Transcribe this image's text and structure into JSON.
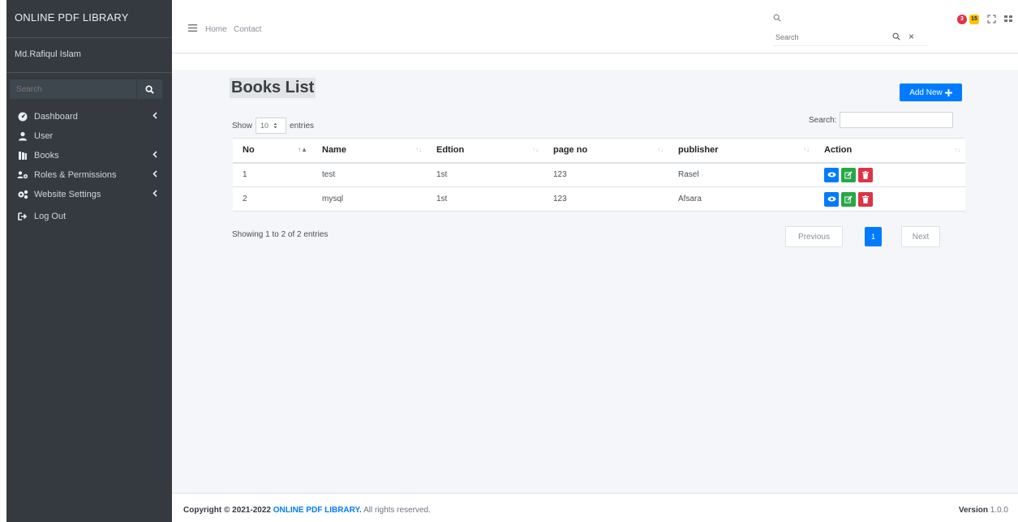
{
  "sidebar": {
    "brand": "ONLINE PDF LIBRARY",
    "user_name": "Md.Rafiqul Islam",
    "search_placeholder": "Search",
    "items": [
      {
        "label": "Dashboard",
        "icon": "tachometer-icon",
        "has_caret": true
      },
      {
        "label": "User",
        "icon": "user-icon",
        "has_caret": false
      },
      {
        "label": "Books",
        "icon": "book-icon",
        "has_caret": true
      },
      {
        "label": "Roles & Permissions",
        "icon": "users-cog-icon",
        "has_caret": true
      },
      {
        "label": "Website Settings",
        "icon": "cogs-icon",
        "has_caret": true
      },
      {
        "label": "Log Out",
        "icon": "sign-out-icon",
        "has_caret": false
      }
    ]
  },
  "topbar": {
    "home_label": "Home",
    "contact_label": "Contact",
    "search_placeholder": "Search",
    "badge_red": "3",
    "badge_yellow": "15"
  },
  "content": {
    "title": "Books List",
    "add_new_label": "Add New",
    "show_label": "Show",
    "entries_value": "10",
    "entries_label": "entries",
    "search_label": "Search:",
    "columns": [
      "No",
      "Name",
      "Edtion",
      "page no",
      "publisher",
      "Action"
    ],
    "rows": [
      {
        "no": "1",
        "name": "test",
        "edition": "1st",
        "page_no": "123",
        "publisher": "Rasel"
      },
      {
        "no": "2",
        "name": "mysql",
        "edition": "1st",
        "page_no": "123",
        "publisher": "Afsara"
      }
    ],
    "info": "Showing 1 to 2 of 2 entries",
    "previous_label": "Previous",
    "current_page": "1",
    "next_label": "Next"
  },
  "footer": {
    "copyright_prefix": "Copyright © 2021-2022",
    "copyright_brand": "ONLINE PDF LIBRARY.",
    "copyright_suffix": "All rights reserved.",
    "version_label": "Version",
    "version_value": "1.0.0"
  },
  "colors": {
    "sidebar_bg": "#343a40",
    "primary": "#007bff",
    "success": "#28a745",
    "danger": "#dc3545",
    "warning": "#ffc107"
  }
}
